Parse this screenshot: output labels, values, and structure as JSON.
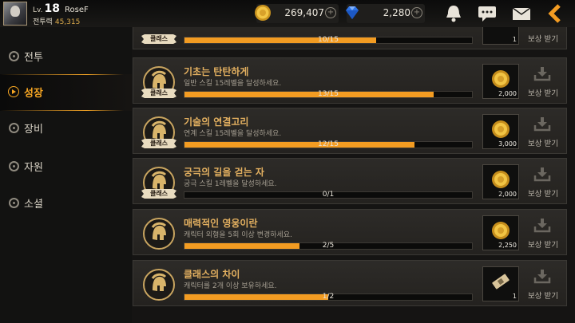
{
  "player": {
    "level_prefix": "Lv.",
    "level": "18",
    "name": "RoseF",
    "power_label": "전투력",
    "power_value": "45,315"
  },
  "currency": {
    "gold": "269,407",
    "gems": "2,280"
  },
  "top_icons": [
    "bell-icon",
    "chat-icon",
    "mail-icon",
    "back-arrow-icon"
  ],
  "sidebar": {
    "items": [
      {
        "label": "전투",
        "active": false
      },
      {
        "label": "성장",
        "active": true
      },
      {
        "label": "장비",
        "active": false
      },
      {
        "label": "자원",
        "active": false
      },
      {
        "label": "소셜",
        "active": false
      }
    ]
  },
  "achievements": [
    {
      "title": "",
      "desc": "",
      "tag": "클래스",
      "progress_text": "10/15",
      "progress": 0.667,
      "reward_icon": "gold-coin",
      "reward_amount": "1",
      "claim_label": "보상 받기"
    },
    {
      "title": "기초는 탄탄하게",
      "desc": "일반 스킬 15레벨을 달성하세요.",
      "tag": "클래스",
      "progress_text": "13/15",
      "progress": 0.867,
      "reward_icon": "gold-coin",
      "reward_amount": "2,000",
      "claim_label": "보상 받기"
    },
    {
      "title": "기술의 연결고리",
      "desc": "연계 스킬 15레벨을 달성하세요.",
      "tag": "클래스",
      "progress_text": "12/15",
      "progress": 0.8,
      "reward_icon": "gold-coin",
      "reward_amount": "3,000",
      "claim_label": "보상 받기"
    },
    {
      "title": "궁극의 길을 걷는 자",
      "desc": "궁극 스킬 1레벨을 달성하세요.",
      "tag": "클래스",
      "progress_text": "0/1",
      "progress": 0.0,
      "reward_icon": "gold-coin",
      "reward_amount": "2,000",
      "claim_label": "보상 받기"
    },
    {
      "title": "매력적인 영웅이란",
      "desc": "캐릭터 외형을 5회 이상 변경하세요.",
      "tag": "",
      "progress_text": "2/5",
      "progress": 0.4,
      "reward_icon": "gold-coin",
      "reward_amount": "2,250",
      "claim_label": "보상 받기"
    },
    {
      "title": "클래스의 차이",
      "desc": "캐릭터를 2개 이상 보유하세요.",
      "tag": "",
      "progress_text": "1/2",
      "progress": 0.5,
      "reward_icon": "ticket",
      "reward_amount": "1",
      "claim_label": "보상 받기"
    }
  ],
  "colors": {
    "accent": "#f39c22",
    "title": "#e3b060",
    "bg": "#151413"
  }
}
